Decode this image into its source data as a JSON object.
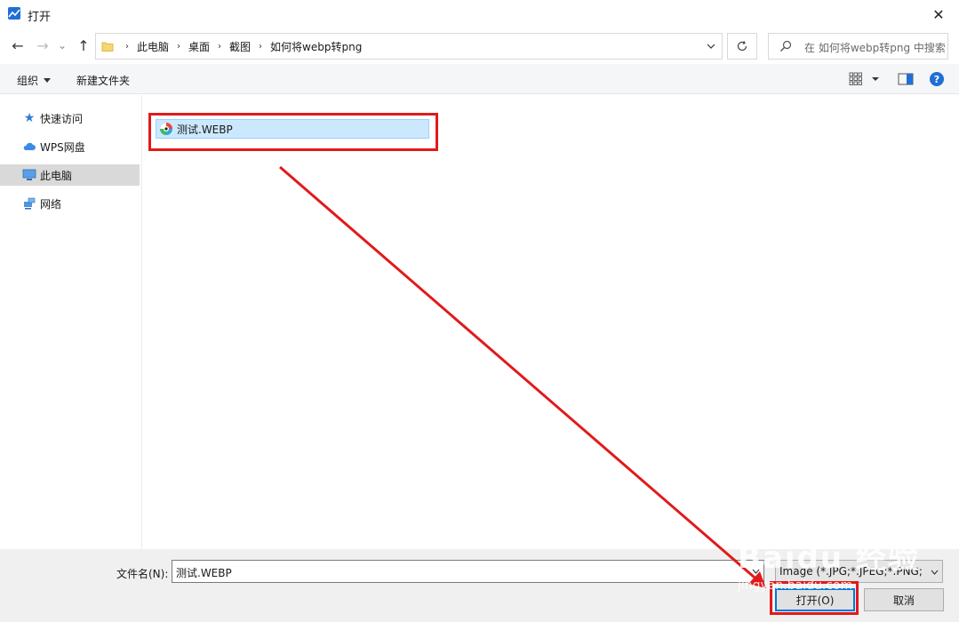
{
  "window": {
    "title": "打开",
    "close_glyph": "✕"
  },
  "nav": {
    "back_glyph": "←",
    "forward_glyph": "→",
    "recent_glyph": "⌄",
    "up_glyph": "↑"
  },
  "address": {
    "crumbs": [
      "此电脑",
      "桌面",
      "截图",
      "如何将webp转png"
    ],
    "separator": "›"
  },
  "search": {
    "placeholder": "在 如何将webp转png 中搜索"
  },
  "toolbar": {
    "organize_label": "组织",
    "new_folder_label": "新建文件夹",
    "help_label": "?"
  },
  "sidebar": {
    "items": [
      {
        "label": "快速访问",
        "icon": "star-icon"
      },
      {
        "label": "WPS网盘",
        "icon": "cloud-icon"
      },
      {
        "label": "此电脑",
        "icon": "computer-icon"
      },
      {
        "label": "网络",
        "icon": "network-icon"
      }
    ],
    "selected_index": 2
  },
  "files": [
    {
      "name": "测试.WEBP",
      "icon": "webp-file-icon",
      "selected": true
    }
  ],
  "bottom": {
    "filename_label": "文件名(N):",
    "filename_value": "测试.WEBP",
    "filter_value": "Image (*.JPG;*.JPEG;*.PNG;*.I",
    "open_label": "打开(O)",
    "cancel_label": "取消"
  },
  "colors": {
    "annotation_red": "#e11a1a",
    "selection_bg": "#cce8ff",
    "accent": "#0078d7"
  },
  "watermark": {
    "text_main": "Baidu 经验",
    "text_sub": "jingyan.baidu.com"
  }
}
